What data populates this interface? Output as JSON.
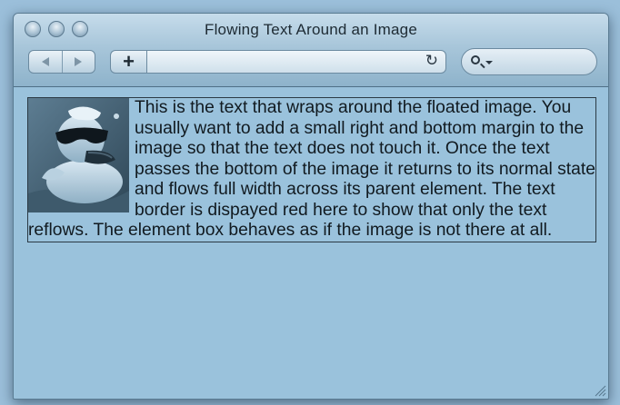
{
  "window": {
    "title": "Flowing Text Around an Image"
  },
  "toolbar": {
    "back_icon": "back-arrow-icon",
    "forward_icon": "forward-arrow-icon",
    "add_label": "+",
    "address_value": "",
    "reload_icon": "reload-icon",
    "reload_glyph": "↻",
    "search_value": "",
    "search_icon": "search-icon"
  },
  "content": {
    "image_icon": "rubber-duck-sunglasses-photo",
    "paragraph": "This is the text that wraps around the floated image. You usually want to add a small right and bottom margin to the image so that the text does not touch it. Once the text passes the bottom of the image it returns to its normal state and flows full width across its parent element. The text border is dispayed red here to show that only the text reflows. The element box behaves as if the image is not there at all."
  },
  "colors": {
    "page_background": "#9bbfda",
    "toolbar_top": "#c6dceb",
    "toolbar_bottom": "#8eb3cb",
    "text": "#111a20",
    "text_border": "#2b3a45"
  }
}
